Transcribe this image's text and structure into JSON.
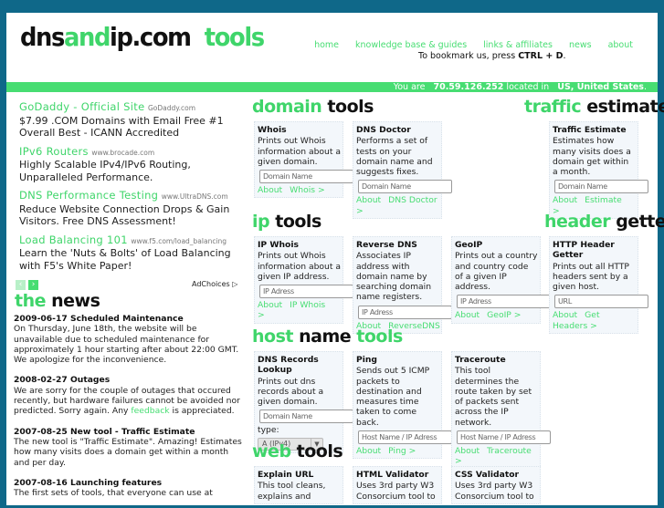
{
  "header": {
    "logo": {
      "part1": "dns",
      "part2": "and",
      "part3": "ip.com",
      "part4": "tools"
    },
    "nav": [
      "home",
      "knowledge base & guides",
      "links & affiliates",
      "news",
      "about"
    ],
    "bookmark_pre": "To bookmark us, press ",
    "bookmark_key": "CTRL + D",
    "bookmark_post": ".",
    "location": {
      "pre": "You are ",
      "ip": "70.59.126.252",
      "mid": " located in ",
      "country": "US, United States",
      "post": "."
    }
  },
  "colors": {
    "accent": "#47dd72",
    "background": "#0f6889"
  },
  "ads": [
    {
      "title": "GoDaddy - Official Site",
      "url": "GoDaddy.com",
      "text": "$7.99 .COM Domains with Email Free #1 Overall Best - ICANN Accredited"
    },
    {
      "title": "IPv6 Routers",
      "url": "www.brocade.com",
      "text": "Highly Scalable IPv4/IPv6 Routing, Unparalleled Performance."
    },
    {
      "title": "DNS Performance Testing",
      "url": "www.UltraDNS.com",
      "text": "Reduce Website Connection Drops & Gain Visitors. Free DNS Assessment!"
    },
    {
      "title": "Load Balancing 101",
      "url": "www.f5.com/load_balancing",
      "text": "Learn the 'Nuts & Bolts' of Load Balancing with F5's White Paper!"
    }
  ],
  "adchoices": "AdChoices",
  "news": {
    "heading_g": "the",
    "heading_k": " news",
    "items": [
      {
        "title": "2009-06-17 Scheduled Maintenance",
        "text": "On Thursday, June 18th, the website will be unavailable due to scheduled maintenance for approximately 1 hour starting after about 22:00 GMT. We apologize for the inconvenience."
      },
      {
        "title": "2008-02-27 Outages",
        "text": "We are sorry for the couple of outages that occured recently, but hardware failures cannot be avoided nor predicted. Sorry again. Any ",
        "link": "feedback",
        "text2": " is appreciated."
      },
      {
        "title": "2007-08-25 New tool - Traffic Estimate",
        "text": "The new tool is \"Traffic Estimate\". Amazing! Estimates how many visits does a domain get within a month and per day."
      },
      {
        "title": "2007-08-16 Launching features",
        "text": "The first sets of tools, that everyone can use at"
      }
    ]
  },
  "sections": [
    {
      "g": "domain",
      "k": " tools",
      "g2": ""
    },
    {
      "g": "traffic",
      "k": " estimate",
      "g2": ""
    },
    {
      "g": "ip",
      "k": " tools",
      "g2": ""
    },
    {
      "g": "header",
      "k": " getter",
      "g2": ""
    },
    {
      "g": "host",
      "k": " name ",
      "g2": "tools"
    },
    {
      "g": "web",
      "k": " tools",
      "g2": ""
    }
  ],
  "tools": [
    {
      "title": "Whois",
      "desc": "Prints out Whois information about a given domain.",
      "placeholder": "Domain Name",
      "about": "About",
      "action": "Whois >"
    },
    {
      "title": "DNS Doctor",
      "desc": "Performs a set of tests on your domain name and suggests fixes.",
      "placeholder": "Domain Name",
      "about": "About",
      "action": "DNS Doctor >"
    },
    {
      "title": "Traffic Estimate",
      "desc": "Estimates how many visits does a domain get within a month.",
      "placeholder": "Domain Name",
      "about": "About",
      "action": "Estimate >"
    },
    {
      "title": "IP Whois",
      "desc": "Prints out Whois information about a given IP address.",
      "placeholder": "IP Adress",
      "about": "About",
      "action": "IP Whois >"
    },
    {
      "title": "Reverse DNS",
      "desc": "Associates IP address with domain name by searching domain name registers.",
      "placeholder": "IP Adress",
      "about": "About",
      "action": "ReverseDNS"
    },
    {
      "title": "GeoIP",
      "desc": "Prints out a country and country code of a given IP address.",
      "placeholder": "IP Adress",
      "about": "About",
      "action": "GeoIP >"
    },
    {
      "title": "HTTP Header Getter",
      "desc": "Prints out all HTTP headers sent by a given host.",
      "placeholder": "URL",
      "about": "About",
      "action": "Get Headers >"
    },
    {
      "title": "DNS Records Lookup",
      "desc": "Prints out dns records about a given domain.",
      "placeholder": "Domain Name",
      "type_label": "type:",
      "type_value": "A (IPv4)"
    },
    {
      "title": "Ping",
      "desc": "Sends out 5 ICMP packets to destination and measures time taken to come back.",
      "placeholder": "Host Name / IP Adress",
      "about": "About",
      "action": "Ping >"
    },
    {
      "title": "Traceroute",
      "desc": "This tool determines the route taken by set of packets sent across the IP network.",
      "placeholder": "Host Name / IP Adress",
      "about": "About",
      "action": "Traceroute >"
    },
    {
      "title": "Explain URL",
      "desc": "This tool cleans, explains and"
    },
    {
      "title": "HTML Validator",
      "desc": "Uses 3rd party W3 Consorcium tool to"
    },
    {
      "title": "CSS Validator",
      "desc": "Uses 3rd party W3 Consorcium tool to"
    }
  ]
}
